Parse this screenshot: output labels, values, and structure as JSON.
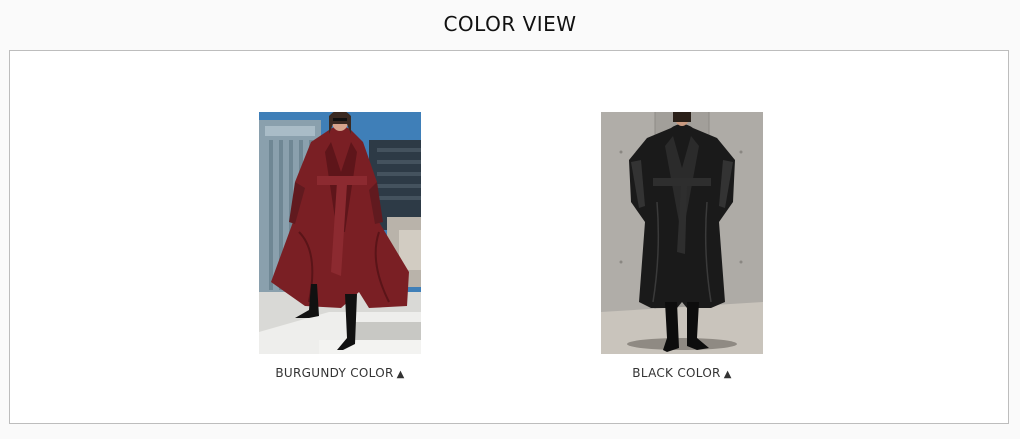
{
  "section": {
    "title": "COLOR VIEW"
  },
  "colors": [
    {
      "label": "BURGUNDY COLOR",
      "arrow": "▲",
      "photo_alt": "burgundy-trench-coat-photo"
    },
    {
      "label": "BLACK COLOR",
      "arrow": "▲",
      "photo_alt": "black-trench-coat-photo"
    }
  ],
  "palette": {
    "burgundy": "#7a1f24",
    "black": "#151515",
    "border": "#bdbdbd"
  }
}
